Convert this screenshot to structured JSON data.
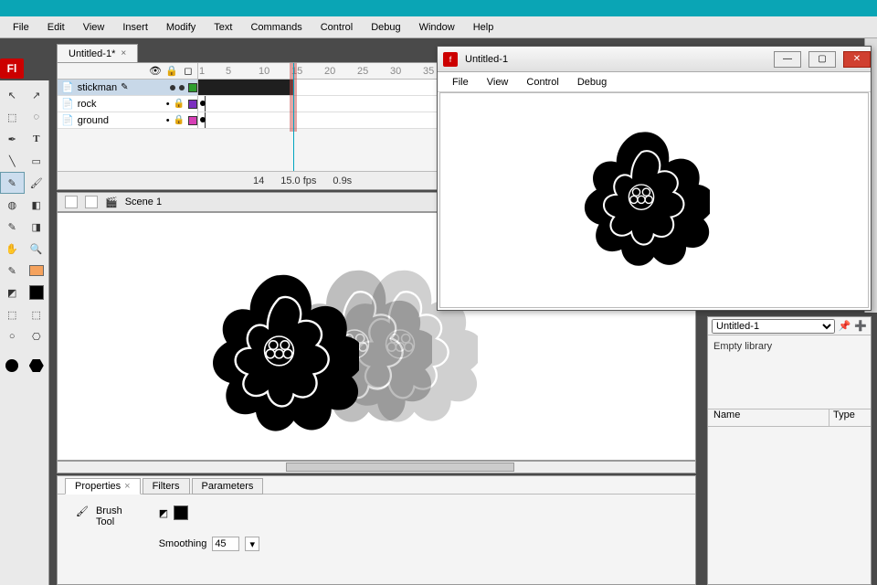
{
  "menubar": [
    "File",
    "Edit",
    "View",
    "Insert",
    "Modify",
    "Text",
    "Commands",
    "Control",
    "Debug",
    "Window",
    "Help"
  ],
  "app_badge": "Fl",
  "doc_tab": {
    "label": "Untitled-1*"
  },
  "scene": {
    "label": "Scene 1"
  },
  "timeline": {
    "layers": [
      {
        "name": "stickman",
        "selected": true,
        "color": "#2e9e2e"
      },
      {
        "name": "rock",
        "selected": false,
        "color": "#7b2fbf"
      },
      {
        "name": "ground",
        "selected": false,
        "color": "#d63fb5"
      }
    ],
    "frame_nums": [
      1,
      5,
      10,
      15,
      20,
      25,
      30,
      35
    ],
    "status": {
      "frame": "14",
      "fps": "15.0 fps",
      "time": "0.9s"
    }
  },
  "props": {
    "tabs": [
      "Properties",
      "Filters",
      "Parameters"
    ],
    "active_tab": 0,
    "tool_line1": "Brush",
    "tool_line2": "Tool",
    "smoothing_label": "Smoothing",
    "smoothing_value": "45"
  },
  "library": {
    "doc": "Untitled-1",
    "empty": "Empty library",
    "cols": [
      "Name",
      "Type"
    ]
  },
  "preview": {
    "title": "Untitled-1",
    "menu": [
      "File",
      "View",
      "Control",
      "Debug"
    ]
  },
  "tool_icons": [
    [
      "↖",
      "▱"
    ],
    [
      "⬚",
      "◌"
    ],
    [
      "✎",
      "T"
    ],
    [
      "╲",
      "▭"
    ],
    [
      "🖌",
      "🖌"
    ],
    [
      "🖊",
      "◧"
    ],
    [
      "✎",
      "◨"
    ],
    [
      "✋",
      "🔍"
    ],
    [
      "✎",
      "▬"
    ],
    [
      "◩",
      "◪"
    ],
    [
      "▦",
      "▦"
    ],
    [
      "○",
      "⎔"
    ]
  ]
}
